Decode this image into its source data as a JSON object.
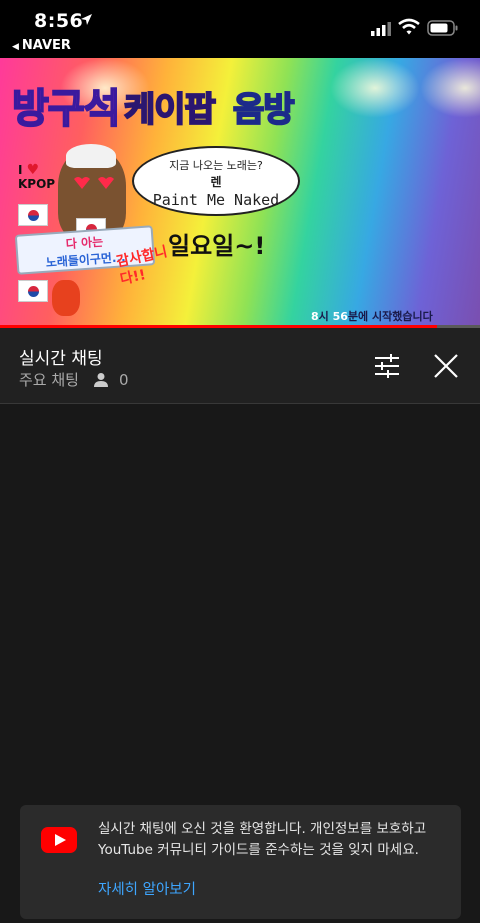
{
  "status_bar": {
    "time": "8:56",
    "back_app": "NAVER"
  },
  "video": {
    "title_part1": "방구석",
    "title_part2": "케이팝",
    "title_part3": "음방",
    "bubble_line1": "지금 나오는 노래는?",
    "bubble_line2": "렌",
    "bubble_line3": "Paint Me Naked",
    "sunday": "일요일~!",
    "i_love": "I",
    "kpop": "KPOP",
    "banner_line1": "다 아는",
    "banner_line2": "노래들이구먼...",
    "thanks_line1": "감사합니",
    "thanks_line2": "다!!",
    "start_hour": "8",
    "start_hour_unit": "시 ",
    "start_min": "56",
    "start_rest": "분에 시작했습니다",
    "progress_fraction": 0.91
  },
  "chat": {
    "title": "실시간 채팅",
    "mode": "주요 채팅",
    "viewer_count": "0"
  },
  "welcome": {
    "message": "실시간 채팅에 오신 것을 환영합니다. 개인정보를 보호하고 YouTube 커뮤니티 가이드를 준수하는 것을 잊지 마세요.",
    "link": "자세히 알아보기"
  },
  "colors": {
    "accent_blue": "#3ea6ff",
    "youtube_red": "#ff0000",
    "panel_bg": "#212121"
  }
}
